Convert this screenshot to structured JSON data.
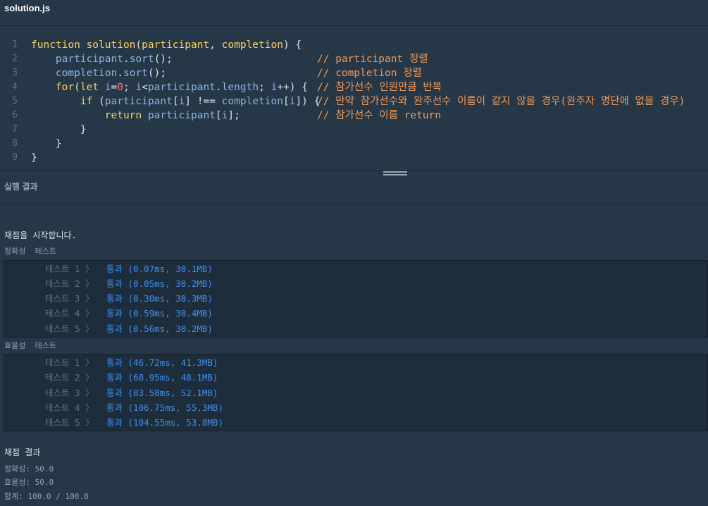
{
  "file": {
    "name": "solution.js"
  },
  "code": {
    "line_numbers": [
      "1",
      "2",
      "3",
      "4",
      "5",
      "6",
      "7",
      "8",
      "9"
    ],
    "comments": {
      "l2": "// participant 정렬",
      "l3": "// completion 정렬",
      "l4": "// 참가선수 인원만큼 반복",
      "l5": "// 만약 참가선수와 완주선수 이름이 같지 않을 경우(완주자 명단에 없을 경우)",
      "l6": "// 참가선수 이름 return"
    }
  },
  "result_panel": {
    "title": "실행 결과",
    "start_message": "채점을 시작합니다.",
    "accuracy": {
      "header": "정확성  테스트",
      "tests": [
        {
          "label": "테스트 1 〉",
          "result": "통과 (0.07ms, 30.1MB)"
        },
        {
          "label": "테스트 2 〉",
          "result": "통과 (0.05ms, 30.2MB)"
        },
        {
          "label": "테스트 3 〉",
          "result": "통과 (0.30ms, 30.3MB)"
        },
        {
          "label": "테스트 4 〉",
          "result": "통과 (0.59ms, 30.4MB)"
        },
        {
          "label": "테스트 5 〉",
          "result": "통과 (0.56ms, 30.2MB)"
        }
      ]
    },
    "efficiency": {
      "header": "효율성  테스트",
      "tests": [
        {
          "label": "테스트 1 〉",
          "result": "통과 (46.72ms, 41.3MB)"
        },
        {
          "label": "테스트 2 〉",
          "result": "통과 (68.95ms, 48.1MB)"
        },
        {
          "label": "테스트 3 〉",
          "result": "통과 (83.58ms, 52.1MB)"
        },
        {
          "label": "테스트 4 〉",
          "result": "통과 (106.75ms, 55.3MB)"
        },
        {
          "label": "테스트 5 〉",
          "result": "통과 (104.55ms, 53.8MB)"
        }
      ]
    },
    "summary": {
      "title": "채점 결과",
      "accuracy": "정확성: 50.0",
      "efficiency": "효율성: 50.0",
      "total": "합계: 100.0 / 100.0"
    }
  },
  "colors": {
    "background": "#263747",
    "pass": "#3f8ef0",
    "comment": "#f09a5a",
    "keyword": "#ffd166"
  }
}
